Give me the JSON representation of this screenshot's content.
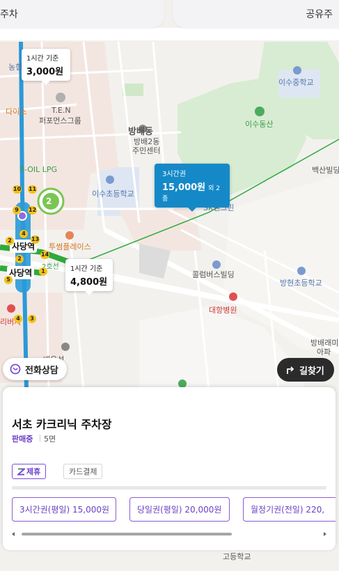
{
  "top_filters": {
    "left_label": "주차",
    "right_label": "공유주"
  },
  "map": {
    "places": {
      "nonghyup": "농협",
      "daiso": "다이소",
      "ten_1": "T.E.N",
      "ten_2": "퍼포먼스그룹",
      "bangbae_dong": "방배동",
      "bangbae2_1": "방배2동",
      "bangbae2_2": "주민센터",
      "soil": "S-OIL LPG",
      "isu_elem": "이수초등학교",
      "isu_middle": "이수중학교",
      "isu_mountain": "이수동산",
      "baeksan": "백산빌딩",
      "sk_enclean": "SK엔크린",
      "twosome": "투썸플레이스",
      "line2": "2호선",
      "sadang1": "사당역",
      "sadang2": "사당역",
      "clumbus": "콜럼버스빌딩",
      "banghyun": "방현초등학교",
      "daehang": "대항병원",
      "bangbae_rae": "방배래미",
      "apartment": "아파",
      "woosung_1": "배우성",
      "woosung_2": "트",
      "riverside": "리버사",
      "high_school": "고등학교"
    },
    "station_badges": [
      "10",
      "11",
      "9",
      "12",
      "13",
      "14",
      "5",
      "1",
      "4",
      "3",
      "4",
      "2",
      "2"
    ],
    "pins": {
      "p1": {
        "sub": "1시간 기준",
        "price": "3,000원"
      },
      "p2": {
        "sub": "3시간권",
        "price": "15,000원",
        "extra": "외 2종"
      },
      "p3": {
        "sub": "1시간 기준",
        "price": "4,800원"
      }
    },
    "cluster_count": "2"
  },
  "actions": {
    "call_label": "전화상담",
    "route_label": "길찾기"
  },
  "lot": {
    "name": "서초 카크리닉 주차장",
    "status": "판매중",
    "spaces": "5면",
    "tags": {
      "partner": "제휴",
      "card": "카드결제"
    },
    "tickets": [
      "3시간권(평일) 15,000원",
      "당일권(평일) 20,000원",
      "월정기권(전일) 220,"
    ]
  },
  "colors": {
    "accent_purple": "#6b3fc4",
    "selected_pin": "#1589c8",
    "line2_green": "#2eaa3c",
    "line4_blue": "#2a9ad8"
  }
}
